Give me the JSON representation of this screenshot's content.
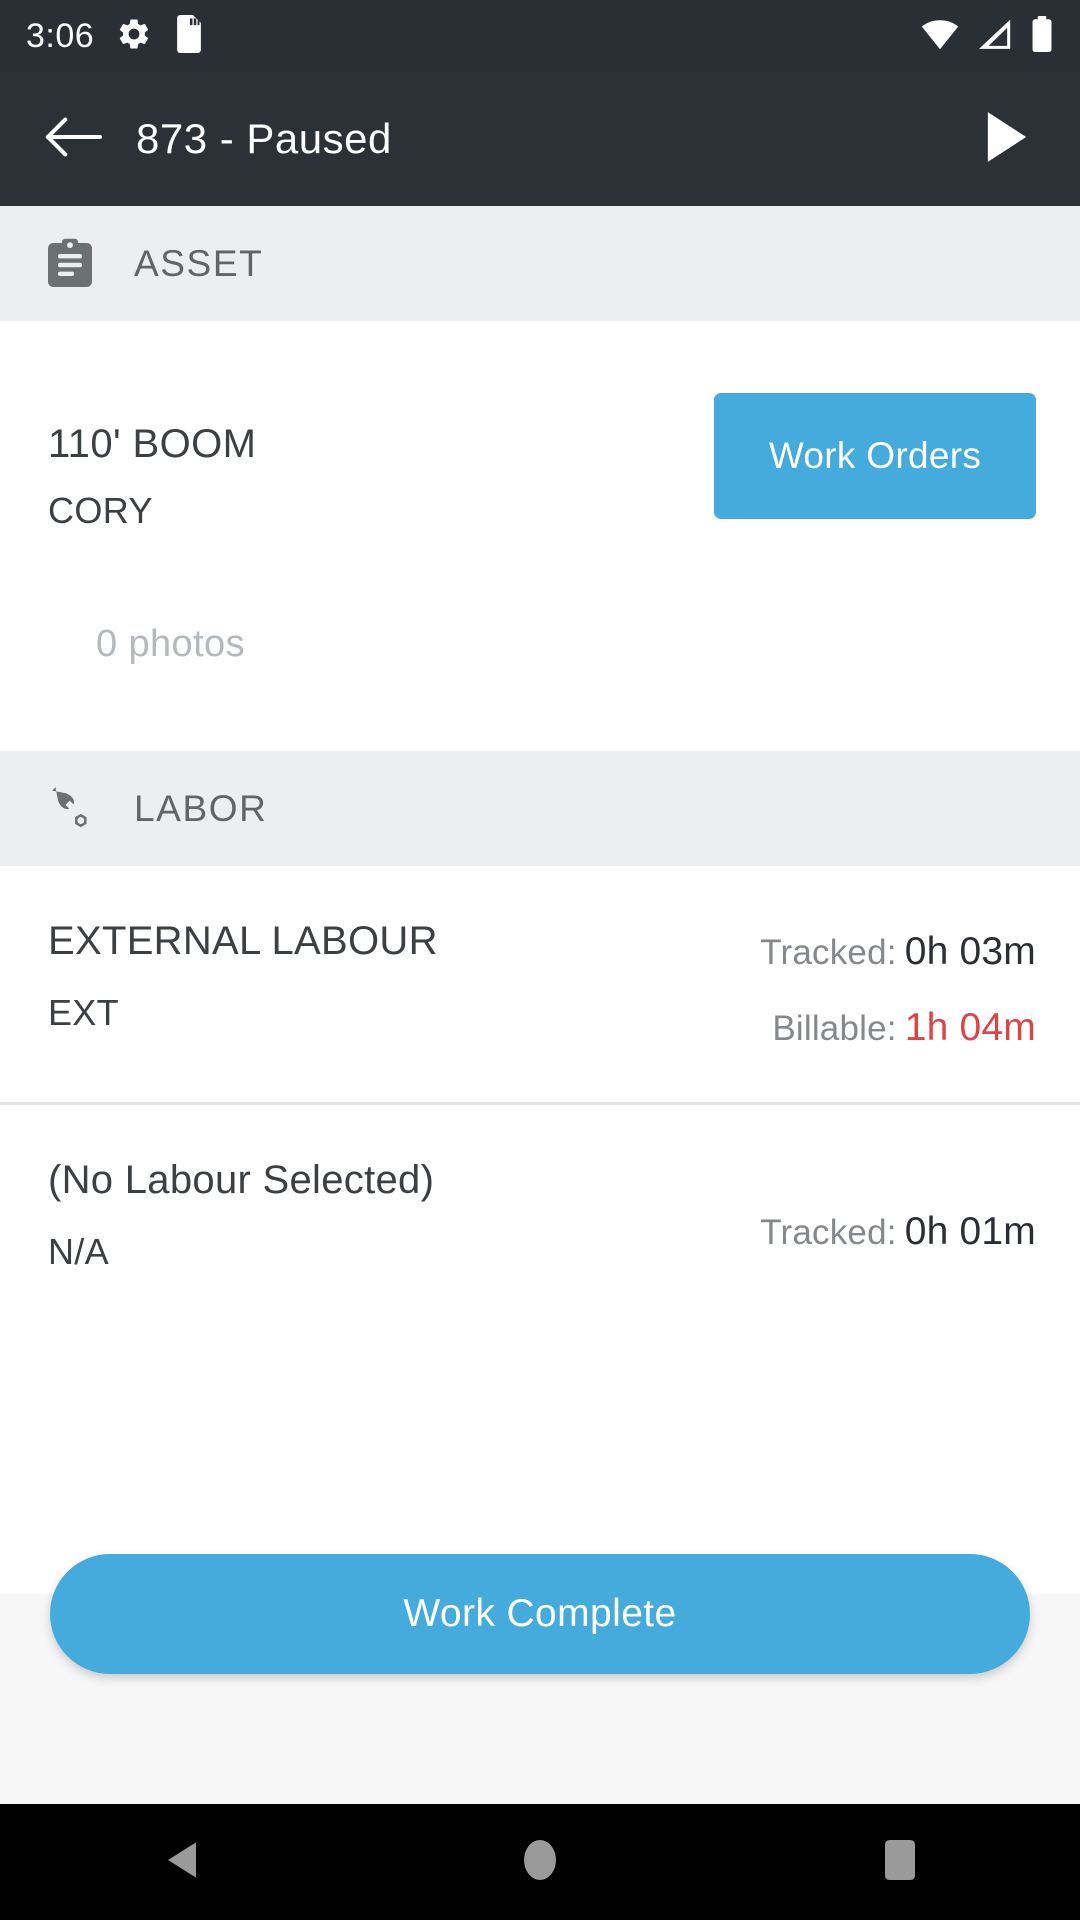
{
  "status_bar": {
    "time": "3:06",
    "icons": [
      "gear-icon",
      "sd-card-icon",
      "wifi-icon",
      "signal-icon",
      "battery-icon"
    ]
  },
  "app_bar": {
    "back_icon": "arrow-left-icon",
    "title": "873 - Paused",
    "play_icon": "play-icon"
  },
  "sections": {
    "asset": {
      "header_label": "ASSET",
      "header_icon": "clipboard-icon",
      "asset_name": "110' BOOM",
      "asset_sub": "CORY",
      "work_orders_button": "Work Orders",
      "photos_label": "0 photos"
    },
    "labor": {
      "header_label": "LABOR",
      "header_icon": "wrench-nut-icon",
      "rows": [
        {
          "title": "EXTERNAL LABOUR",
          "sub": "EXT",
          "tracked_label": "Tracked:",
          "tracked_value": "0h 03m",
          "billable_label": "Billable:",
          "billable_value": "1h 04m"
        },
        {
          "title": "(No Labour Selected)",
          "sub": "N/A",
          "tracked_label": "Tracked:",
          "tracked_value": "0h 01m"
        }
      ]
    }
  },
  "footer": {
    "work_complete_button": "Work Complete"
  },
  "nav_bar": {
    "back_icon": "nav-back-triangle-icon",
    "home_icon": "nav-home-circle-icon",
    "recents_icon": "nav-recents-square-icon"
  },
  "colors": {
    "accent": "#45aadc",
    "appbar": "#2b3137",
    "statusbar": "#292f35",
    "section_band": "#eceef0",
    "billable_red": "#e04343",
    "muted_text": "#86898c",
    "photos_text": "#b4b9bd"
  }
}
